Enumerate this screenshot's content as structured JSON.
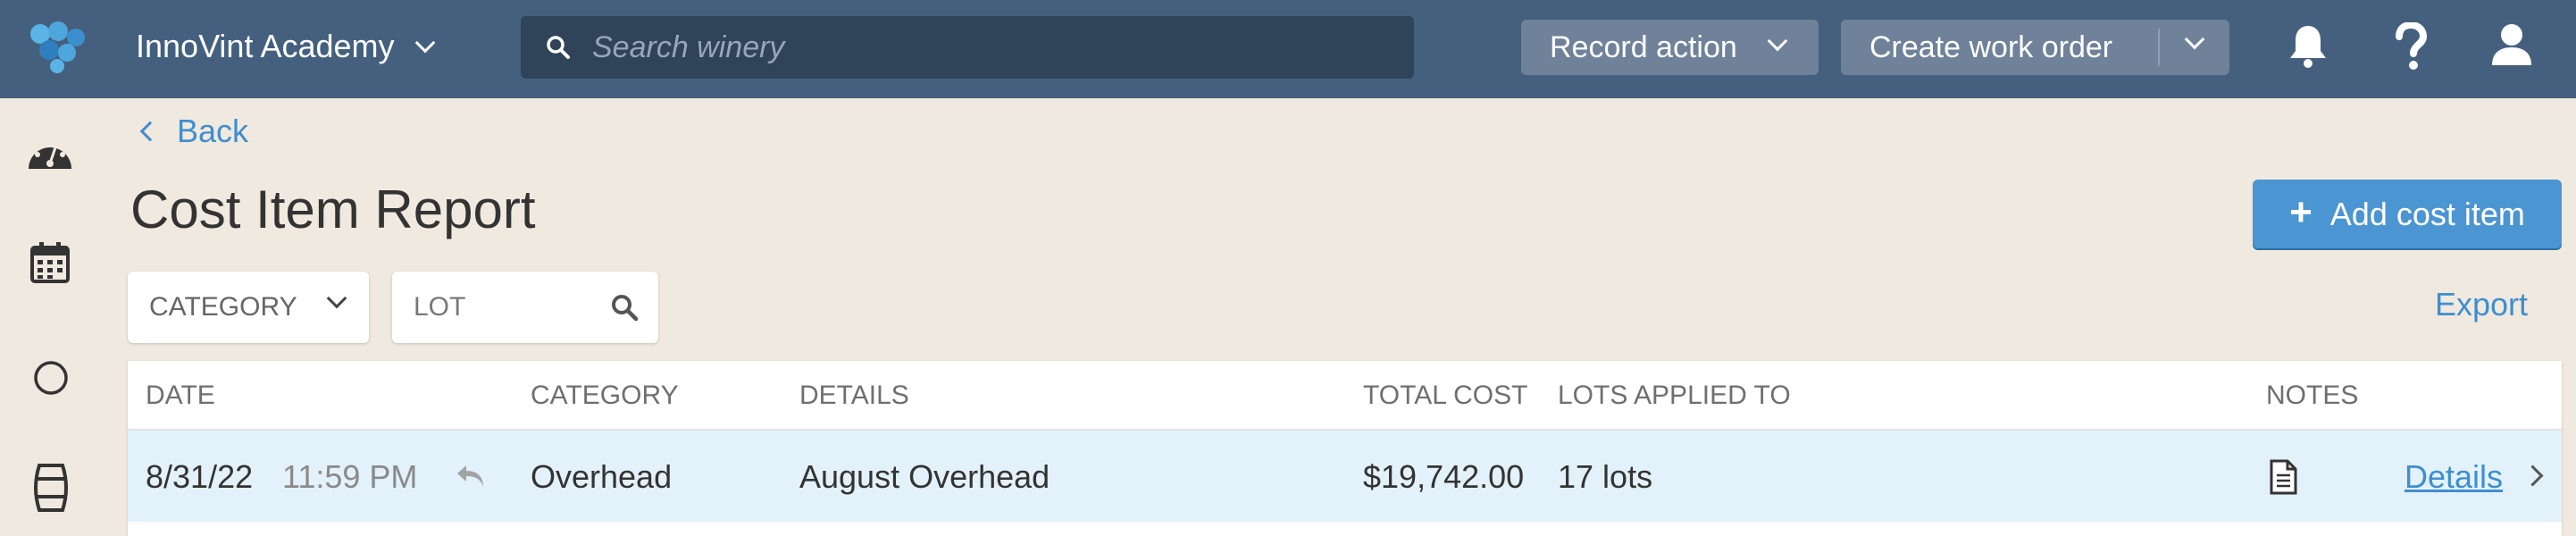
{
  "topbar": {
    "org_name": "InnoVint Academy",
    "search_placeholder": "Search winery",
    "record_action_label": "Record action",
    "create_work_order_label": "Create work order"
  },
  "page": {
    "back_label": "Back",
    "title": "Cost Item Report",
    "add_button_label": "Add cost item",
    "export_label": "Export"
  },
  "filters": {
    "category_label": "CATEGORY",
    "lot_placeholder": "LOT"
  },
  "table": {
    "headers": {
      "date": "DATE",
      "category": "CATEGORY",
      "details": "DETAILS",
      "total_cost": "TOTAL COST",
      "lots_applied_to": "LOTS APPLIED TO",
      "notes": "NOTES"
    },
    "rows": [
      {
        "date": "8/31/22",
        "time": "11:59 PM",
        "category": "Overhead",
        "details": "August Overhead",
        "total_cost": "$19,742.00",
        "lots": "17 lots",
        "details_link": "Details"
      }
    ]
  },
  "colors": {
    "topbar": "#44607e",
    "accent": "#4b95d2",
    "background": "#f0e9df",
    "row_highlight": "#e3f1fa"
  },
  "icons": {
    "logo": "grape-cluster-logo",
    "search": "search-icon",
    "notifications": "bell-icon",
    "help": "question-icon",
    "user": "user-icon",
    "sidebar": [
      "dashboard-gauge-icon",
      "calendar-icon",
      "circle-icon",
      "barrel-icon"
    ],
    "row_undo": "undo-arrow-icon",
    "notes": "document-icon"
  }
}
